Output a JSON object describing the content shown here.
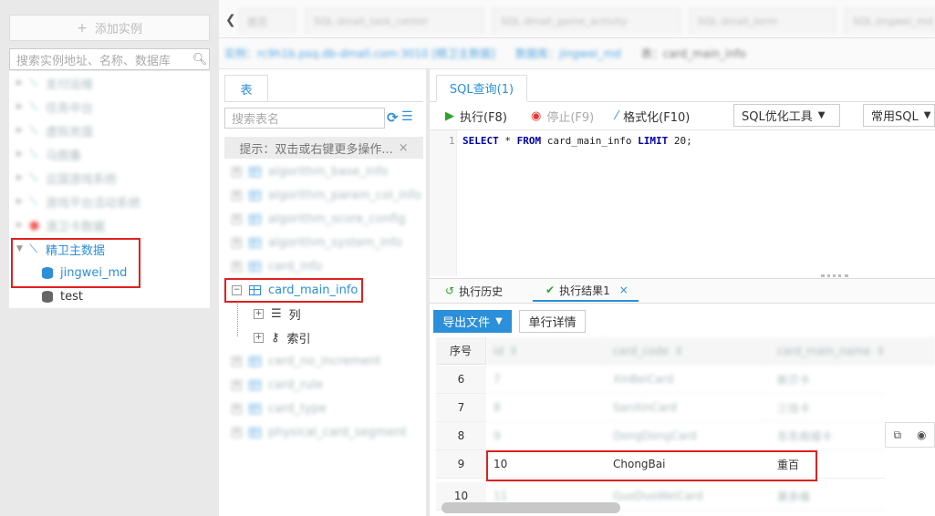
{
  "left": {
    "add_instance": "添加实例",
    "search_placeholder": "搜索实例地址、名称、数据库",
    "tree_blurred": [
      "支付运维",
      "任务中台",
      "虚拟充值",
      "马图番",
      "云国游戏系统",
      "游戏平台活动系统",
      "澳卫卡数据"
    ],
    "tree_active_parent": "精卫主数据",
    "tree_active_db": "jingwei_md",
    "tree_other_db": "test"
  },
  "top_tabs": [
    "首页",
    "SQL dmall_task_center",
    "SQL dmall_game_activity",
    "SQL dmall_term",
    "SQL jingwei_md"
  ],
  "breadcrumb": {
    "instance_label": "实例：",
    "instance_value": "rc9h1b.psq.db-dmall.com:3010 [精卫主数据]",
    "db_label": "数据库：",
    "db_value": "jingwei_md",
    "table_label": "表：",
    "table_value": "card_main_info"
  },
  "tables_panel": {
    "tab": "表",
    "search_placeholder": "搜索表名",
    "hint": "提示：双击或右键更多操作...",
    "tables_before": [
      "algorithm_base_info",
      "algorithm_param_col_info",
      "algorithm_score_config",
      "algorithm_system_info",
      "card_info"
    ],
    "selected_table": "card_main_info",
    "children": [
      "列",
      "索引"
    ],
    "tables_after": [
      "card_no_increment",
      "card_rule",
      "card_type",
      "physical_card_segment"
    ]
  },
  "editor": {
    "tab": "SQL查询(1)",
    "run": "执行(F8)",
    "stop": "停止(F9)",
    "format": "格式化(F10)",
    "optimizer": "SQL优化工具",
    "common_sql": "常用SQL",
    "line": "1",
    "sql_kw1": "SELECT",
    "sql_star": " * ",
    "sql_kw2": "FROM",
    "sql_table": " card_main_info ",
    "sql_kw3": "LIMIT",
    "sql_end": " 20;"
  },
  "results": {
    "history_tab": "执行历史",
    "result_tab": "执行结果1",
    "export": "导出文件",
    "single_row": "单行详情",
    "columns": [
      "序号",
      "id",
      "card_code",
      "card_main_name"
    ],
    "rows": [
      {
        "no": "6",
        "id": "7",
        "code": "XinBeiCard",
        "name": "新贝卡"
      },
      {
        "no": "7",
        "id": "8",
        "code": "SanXinCard",
        "name": "三信卡"
      },
      {
        "no": "8",
        "id": "9",
        "code": "DongDongCard",
        "name": "东东商城卡"
      },
      {
        "no": "9",
        "id": "10",
        "code": "ChongBai",
        "name": "重百"
      },
      {
        "no": "10",
        "id": "11",
        "code": "GuoDuoWeiCard",
        "name": "果多维"
      }
    ]
  }
}
